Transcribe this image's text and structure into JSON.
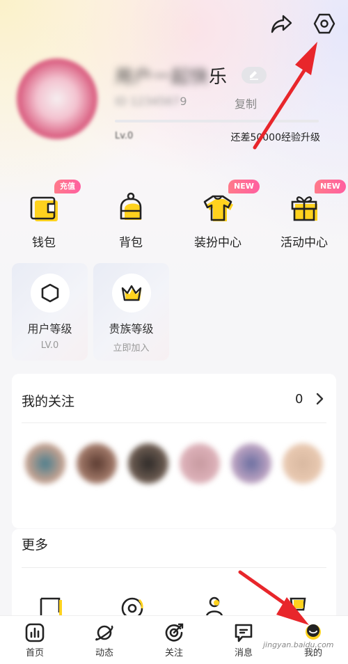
{
  "header": {
    "share_icon": "share-icon",
    "settings_icon": "settings-hex-icon"
  },
  "profile": {
    "name_blurred": "用户一起快",
    "name_tail": "乐",
    "uid_blurred": "ID 1234567",
    "uid_tail": "9",
    "copy_label": "复制",
    "level_blurred": "Lv.0",
    "upgrade_text": "还差50000经验升级",
    "exp_progress": 0
  },
  "actions": [
    {
      "label": "钱包",
      "icon": "wallet-icon",
      "badge": "充值"
    },
    {
      "label": "背包",
      "icon": "backpack-icon",
      "badge": ""
    },
    {
      "label": "装扮中心",
      "icon": "tshirt-icon",
      "badge": "NEW"
    },
    {
      "label": "活动中心",
      "icon": "gift-icon",
      "badge": "NEW"
    }
  ],
  "cards": [
    {
      "title": "用户等级",
      "sub": "LV.0",
      "icon": "hexagon-icon"
    },
    {
      "title": "贵族等级",
      "sub": "立即加入",
      "icon": "crown-icon"
    }
  ],
  "follow": {
    "title": "我的关注",
    "count": "0"
  },
  "more": {
    "title": "更多"
  },
  "tabs": [
    {
      "label": "首页",
      "icon": "chart-icon"
    },
    {
      "label": "动态",
      "icon": "planet-icon"
    },
    {
      "label": "关注",
      "icon": "target-icon"
    },
    {
      "label": "消息",
      "icon": "message-icon"
    },
    {
      "label": "我的",
      "icon": "profile-icon"
    }
  ],
  "watermark": "jingyan.baidu.com",
  "colors": {
    "accent_yellow": "#ffd21e",
    "badge_pink": "#ff6a94",
    "annotation_red": "#e8262b"
  }
}
